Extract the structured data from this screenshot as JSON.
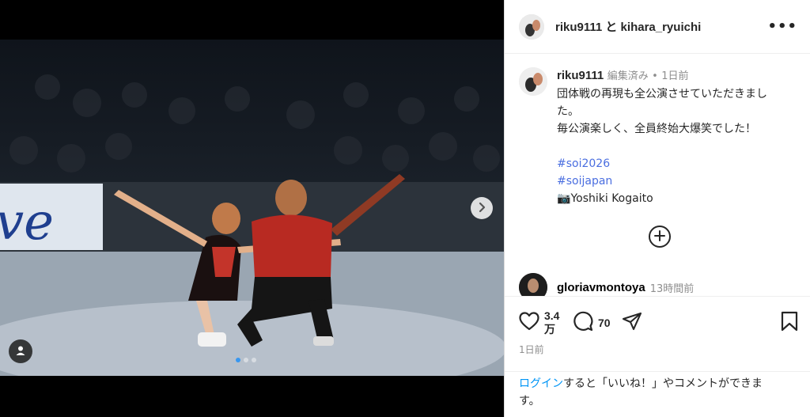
{
  "header": {
    "title": "riku9111 と kihara_ryuichi",
    "more_label": "•••"
  },
  "caption": {
    "username": "riku9111",
    "edited": "編集済み",
    "separator": "•",
    "time": "1日前",
    "line1": "団体戦の再現も全公演させていただきまし",
    "line2": "た。",
    "line3": "毎公演楽しく、全員終始大爆笑でした！",
    "hashtag1": "#soi2026",
    "hashtag2": "#soijapan",
    "photo_credit_icon": "📷",
    "photo_credit": "Yoshiki Kogaito"
  },
  "comment": {
    "username": "gloriavmontoya",
    "time": "13時間前"
  },
  "actions": {
    "likes_line1": "3.4",
    "likes_line2": "万",
    "comments_count": "70",
    "posted": "1日前"
  },
  "login": {
    "link": "ログイン",
    "text_line1": "すると「いいね！」やコメントができま",
    "text_line2": "す。"
  },
  "media": {
    "banner_text": "ve",
    "carousel": {
      "count": 3,
      "active": 1
    }
  },
  "colors": {
    "link": "#0095f6",
    "hashtag": "#4a6ee0",
    "active_dot": "#3897f0"
  }
}
